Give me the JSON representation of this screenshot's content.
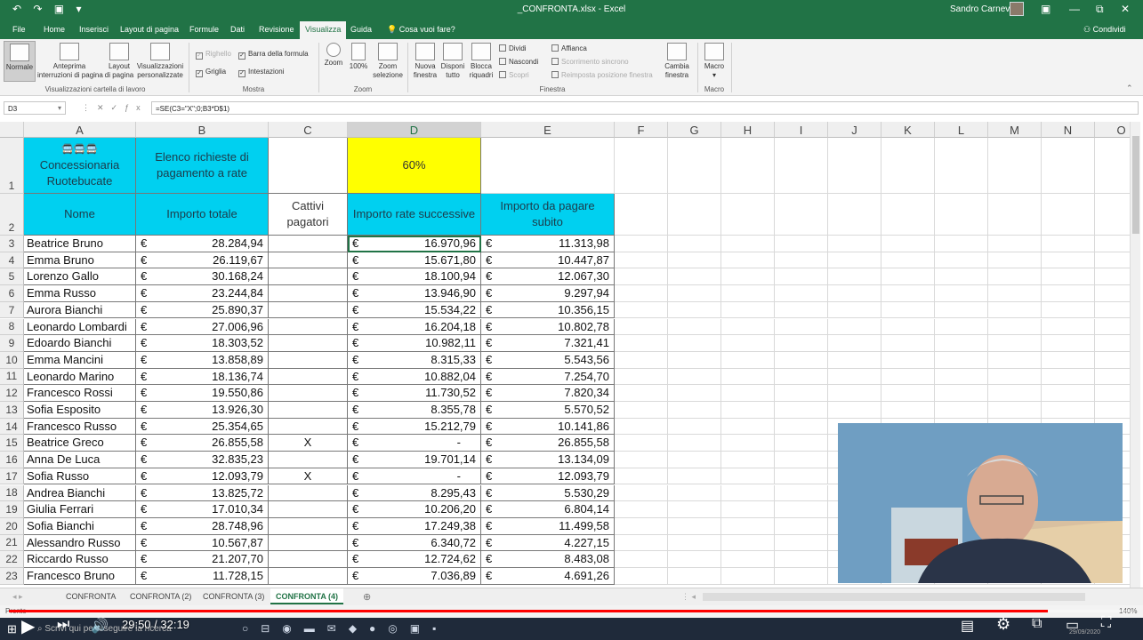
{
  "window": {
    "title": "_CONFRONTA.xlsx - Excel",
    "user": "Sandro Carnevali"
  },
  "menu": {
    "tabs": [
      "File",
      "Home",
      "Inserisci",
      "Layout di pagina",
      "Formule",
      "Dati",
      "Revisione",
      "Visualizza",
      "Guida"
    ],
    "active_tab": "Visualizza",
    "tellme": "Cosa vuoi fare?",
    "share": "Condividi"
  },
  "ribbon": {
    "views": {
      "normal": "Normale",
      "preview_line1": "Anteprima",
      "preview_line2": "interruzioni di pagina",
      "layout_line1": "Layout",
      "layout_line2": "di pagina",
      "custom_line1": "Visualizzazioni",
      "custom_line2": "personalizzate",
      "group": "Visualizzazioni cartella di lavoro"
    },
    "show": {
      "ruler": "Righello",
      "formula_bar": "Barra della formula",
      "gridlines": "Griglia",
      "headings": "Intestazioni",
      "group": "Mostra"
    },
    "zoom": {
      "zoom": "Zoom",
      "hundred": "100%",
      "selection_line1": "Zoom",
      "selection_line2": "selezione",
      "group": "Zoom"
    },
    "window": {
      "new_line1": "Nuova",
      "new_line2": "finestra",
      "arrange_line1": "Disponi",
      "arrange_line2": "tutto",
      "freeze_line1": "Blocca",
      "freeze_line2": "riquadri",
      "split": "Dividi",
      "hide": "Nascondi",
      "unhide": "Scopri",
      "side_by_side": "Affianca",
      "sync_scroll": "Scorrimento sincrono",
      "reset_pos": "Reimposta posizione finestra",
      "switch_line1": "Cambia",
      "switch_line2": "finestra",
      "group": "Finestra"
    },
    "macro": {
      "label": "Macro",
      "group": "Macro"
    }
  },
  "formula_bar": {
    "cell_ref": "D3",
    "formula": "=SE(C3=\"X\";0;B3*D$1)"
  },
  "grid": {
    "columns": [
      "A",
      "B",
      "C",
      "D",
      "E",
      "F",
      "G",
      "H",
      "I",
      "J",
      "K",
      "L",
      "M",
      "N",
      "O"
    ],
    "selected_column": "D",
    "row1": {
      "a_icons": "🚍🚍🚍",
      "a_text": "Concessionaria Ruotebucate",
      "b_text": "Elenco richieste di pagamento a rate",
      "d_text": "60%"
    },
    "headers": {
      "name": "Nome",
      "total": "Importo totale",
      "bad": "Cattivi pagatori",
      "installments": "Importo rate successive",
      "upfront": "Importo da pagare subito"
    },
    "currency": "€",
    "rows": [
      {
        "n": "3",
        "name": "Beatrice Bruno",
        "total": "28.284,94",
        "bad": "",
        "rate": "16.970,96",
        "now": "11.313,98"
      },
      {
        "n": "4",
        "name": "Emma Bruno",
        "total": "26.119,67",
        "bad": "",
        "rate": "15.671,80",
        "now": "10.447,87"
      },
      {
        "n": "5",
        "name": "Lorenzo Gallo",
        "total": "30.168,24",
        "bad": "",
        "rate": "18.100,94",
        "now": "12.067,30"
      },
      {
        "n": "6",
        "name": "Emma Russo",
        "total": "23.244,84",
        "bad": "",
        "rate": "13.946,90",
        "now": "9.297,94"
      },
      {
        "n": "7",
        "name": "Aurora Bianchi",
        "total": "25.890,37",
        "bad": "",
        "rate": "15.534,22",
        "now": "10.356,15"
      },
      {
        "n": "8",
        "name": "Leonardo Lombardi",
        "total": "27.006,96",
        "bad": "",
        "rate": "16.204,18",
        "now": "10.802,78"
      },
      {
        "n": "9",
        "name": "Edoardo Bianchi",
        "total": "18.303,52",
        "bad": "",
        "rate": "10.982,11",
        "now": "7.321,41"
      },
      {
        "n": "10",
        "name": "Emma Mancini",
        "total": "13.858,89",
        "bad": "",
        "rate": "8.315,33",
        "now": "5.543,56"
      },
      {
        "n": "11",
        "name": "Leonardo Marino",
        "total": "18.136,74",
        "bad": "",
        "rate": "10.882,04",
        "now": "7.254,70"
      },
      {
        "n": "12",
        "name": "Francesco Rossi",
        "total": "19.550,86",
        "bad": "",
        "rate": "11.730,52",
        "now": "7.820,34"
      },
      {
        "n": "13",
        "name": "Sofia Esposito",
        "total": "13.926,30",
        "bad": "",
        "rate": "8.355,78",
        "now": "5.570,52"
      },
      {
        "n": "14",
        "name": "Francesco Russo",
        "total": "25.354,65",
        "bad": "",
        "rate": "15.212,79",
        "now": "10.141,86"
      },
      {
        "n": "15",
        "name": "Beatrice Greco",
        "total": "26.855,58",
        "bad": "X",
        "rate": "-",
        "now": "26.855,58"
      },
      {
        "n": "16",
        "name": "Anna De Luca",
        "total": "32.835,23",
        "bad": "",
        "rate": "19.701,14",
        "now": "13.134,09"
      },
      {
        "n": "17",
        "name": "Sofia Russo",
        "total": "12.093,79",
        "bad": "X",
        "rate": "-",
        "now": "12.093,79"
      },
      {
        "n": "18",
        "name": "Andrea Bianchi",
        "total": "13.825,72",
        "bad": "",
        "rate": "8.295,43",
        "now": "5.530,29"
      },
      {
        "n": "19",
        "name": "Giulia Ferrari",
        "total": "17.010,34",
        "bad": "",
        "rate": "10.206,20",
        "now": "6.804,14"
      },
      {
        "n": "20",
        "name": "Sofia Bianchi",
        "total": "28.748,96",
        "bad": "",
        "rate": "17.249,38",
        "now": "11.499,58"
      },
      {
        "n": "21",
        "name": "Alessandro Russo",
        "total": "10.567,87",
        "bad": "",
        "rate": "6.340,72",
        "now": "4.227,15"
      },
      {
        "n": "22",
        "name": "Riccardo Russo",
        "total": "21.207,70",
        "bad": "",
        "rate": "12.724,62",
        "now": "8.483,08"
      },
      {
        "n": "23",
        "name": "Francesco Bruno",
        "total": "11.728,15",
        "bad": "",
        "rate": "7.036,89",
        "now": "4.691,26"
      }
    ]
  },
  "sheets": {
    "tabs": [
      "CONFRONTA",
      "CONFRONTA (2)",
      "CONFRONTA (3)",
      "CONFRONTA (4)"
    ],
    "active": "CONFRONTA (4)"
  },
  "status": {
    "ready": "Pronto",
    "zoom": "140%"
  },
  "taskbar": {
    "search": "Scrivi qui per eseguire la ricerca",
    "date": "29/09/2020"
  },
  "player": {
    "time": "29:50 / 32:19",
    "progress": 0.923
  },
  "colors": {
    "excel_green": "#217346",
    "cyan_header": "#00d0f0",
    "yellow_pct": "#ffff00"
  }
}
